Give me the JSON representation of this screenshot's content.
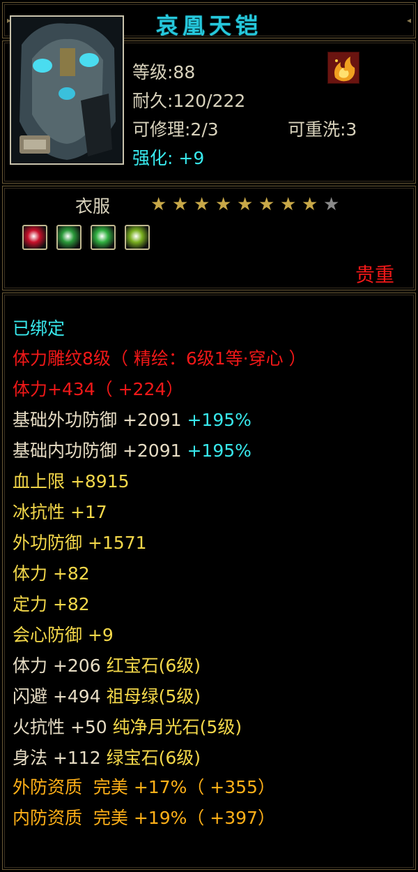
{
  "title": "哀凰天铠",
  "info": {
    "level": "等级:88",
    "durability": "耐久:120/222",
    "repair": "可修理:2/3",
    "rewash": "可重洗:3",
    "enhance_label": "强化:",
    "enhance_value": "+9"
  },
  "type": {
    "name": "衣服",
    "stars_filled": 8,
    "stars_total": 9,
    "rarity": "贵重"
  },
  "colors": {
    "cyan": "#38e8ec",
    "red": "#f01818",
    "white": "#e6dcc4",
    "yellow": "#f4d84a",
    "gold": "#ffb018"
  },
  "gems": [
    {
      "icon": "red-gem-icon",
      "color": "#c8102a"
    },
    {
      "icon": "green-gem-icon",
      "color": "#2a9a3a"
    },
    {
      "icon": "green-crescent-gem-icon",
      "color": "#30b040"
    },
    {
      "icon": "gold-green-gem-icon",
      "color": "#7ab020"
    }
  ],
  "flame_icon": "flame-badge-icon",
  "stats": {
    "bound": "已绑定",
    "engrave": "体力雕纹8级（ 精绘：6级1等·穿心 ）",
    "stamina_bonus": "体力+434（ +224）",
    "base_ext_def": "基础外功防御 +2091",
    "base_ext_def_pct": "+195%",
    "base_int_def": "基础内功防御 +2091",
    "base_int_def_pct": "+195%",
    "hp_cap": "血上限 +8915",
    "ice_res": "冰抗性 +17",
    "ext_def": "外功防御 +1571",
    "stamina": "体力 +82",
    "focus": "定力 +82",
    "crit_def": "会心防御 +9",
    "gem1_stat": "体力 +206",
    "gem1_name": "红宝石(6级)",
    "gem2_stat": "闪避 +494",
    "gem2_name": "祖母绿(5级)",
    "gem3_stat": "火抗性 +50",
    "gem3_name": "纯净月光石(5级)",
    "gem4_stat": "身法 +112",
    "gem4_name": "绿宝石(6级)",
    "ext_quality": "外防资质  完美 +17%（ +355）",
    "int_quality": "内防资质  完美 +19%（ +397）"
  }
}
